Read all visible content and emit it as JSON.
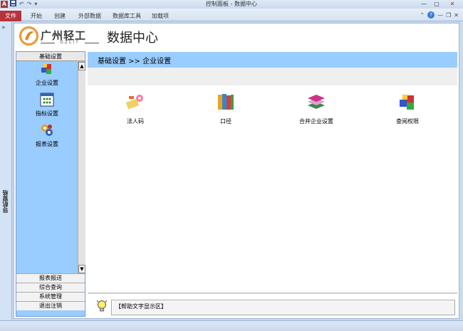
{
  "window": {
    "title": "控制面板 - 数据中心",
    "app_icon_letter": "A",
    "quick_access": [
      "save-icon",
      "undo-icon",
      "redo-icon",
      "customize-icon"
    ],
    "controls": [
      "minimize-icon",
      "maximize-icon",
      "close-icon"
    ]
  },
  "ribbon": {
    "file_tab": "文件",
    "tabs": [
      "开始",
      "创建",
      "外部数据",
      "数据库工具",
      "加载项"
    ]
  },
  "nav_pane": {
    "label": "导航窗格",
    "toggle": "»"
  },
  "header": {
    "logo_text": "广州轻工",
    "logo_sub": "GZLIT",
    "page_title": "数据中心"
  },
  "left_menu": {
    "heading": "基础设置",
    "items": [
      {
        "label": "企业设置",
        "icon": "blocks-icon"
      },
      {
        "label": "指标设置",
        "icon": "grid-dots-icon"
      },
      {
        "label": "报表设置",
        "icon": "gears-icon"
      }
    ],
    "footer_items": [
      "报表报送",
      "综合查询",
      "系统管理",
      "退出注销"
    ]
  },
  "breadcrumb": "基础设置  >>  企业设置",
  "tiles": [
    {
      "label": "法人码",
      "icon": "keys-icon"
    },
    {
      "label": "口径",
      "icon": "books-icon"
    },
    {
      "label": "合并企业设置",
      "icon": "stack-icon"
    },
    {
      "label": "查阅权限",
      "icon": "blocks-icon"
    }
  ],
  "help": {
    "text": "【帮助文字显示区】",
    "icon": "lightbulb-icon"
  },
  "colors": {
    "menu_bg": "#99ccff",
    "file_tab": "#b7333b",
    "window_bg": "#c8dcef"
  }
}
